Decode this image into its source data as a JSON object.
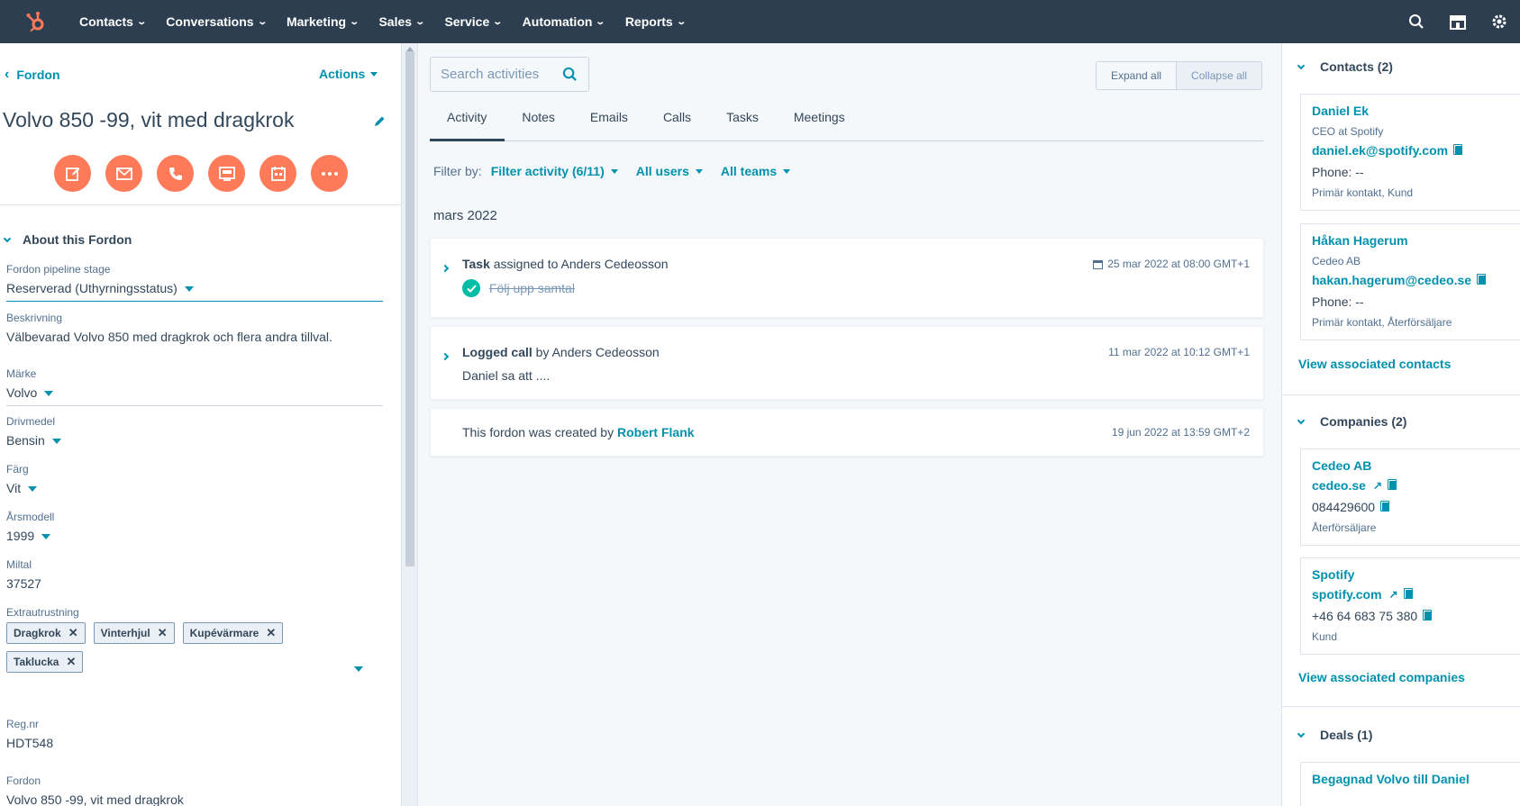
{
  "nav": {
    "items": [
      "Contacts",
      "Conversations",
      "Marketing",
      "Sales",
      "Service",
      "Automation",
      "Reports"
    ],
    "brand_color": "#ff7a59",
    "icons": [
      "search-icon",
      "marketplace-icon",
      "settings-icon"
    ]
  },
  "record": {
    "back_label": "Fordon",
    "actions_label": "Actions",
    "title": "Volvo 850 -99, vit med dragkrok",
    "action_icons": [
      "note-icon",
      "email-icon",
      "call-icon",
      "log-icon",
      "task-icon",
      "more-icon"
    ]
  },
  "about": {
    "heading": "About this Fordon",
    "pipeline_label": "Fordon pipeline stage",
    "pipeline_value": "Reserverad (Uthyrningsstatus)",
    "desc_label": "Beskrivning",
    "desc_value": "Välbevarad Volvo 850 med dragkrok och flera andra tillval.",
    "make_label": "Märke",
    "make_value": "Volvo",
    "fuel_label": "Drivmedel",
    "fuel_value": "Bensin",
    "color_label": "Färg",
    "color_value": "Vit",
    "year_label": "Årsmodell",
    "year_value": "1999",
    "mileage_label": "Miltal",
    "mileage_value": "37527",
    "extras_label": "Extrautrustning",
    "extras": [
      "Dragkrok",
      "Vinterhjul",
      "Kupévärmare",
      "Taklucka"
    ],
    "reg_label": "Reg.nr",
    "reg_value": "HDT548",
    "fordon_label": "Fordon",
    "fordon_value": "Volvo 850 -99, vit med dragkrok"
  },
  "activity": {
    "search_placeholder": "Search activities",
    "expand_all": "Expand all",
    "collapse_all": "Collapse all",
    "tabs": [
      "Activity",
      "Notes",
      "Emails",
      "Calls",
      "Tasks",
      "Meetings"
    ],
    "filter_by": "Filter by:",
    "filter_activity": "Filter activity (6/11)",
    "all_users": "All users",
    "all_teams": "All teams",
    "month": "mars 2022",
    "items": [
      {
        "type": "Task",
        "rest": " assigned to Anders Cedeosson",
        "date": "25 mar 2022 at 08:00 GMT+1",
        "body": "Följ upp samtal"
      },
      {
        "type": "Logged call",
        "rest": " by Anders Cedeosson",
        "date": "11 mar 2022 at 10:12 GMT+1",
        "body": "Daniel sa att ...."
      },
      {
        "text": "This fordon was created by ",
        "author": "Robert Flank",
        "date": "19 jun 2022 at 13:59 GMT+2"
      }
    ]
  },
  "sidebar": {
    "contacts_heading": "Contacts (2)",
    "contacts": [
      {
        "name": "Daniel Ek",
        "title": "CEO at Spotify",
        "email": "daniel.ek@spotify.com",
        "phone": "Phone: --",
        "tags": "Primär kontakt, Kund"
      },
      {
        "name": "Håkan Hagerum",
        "title": "Cedeo AB",
        "email": "hakan.hagerum@cedeo.se",
        "phone": "Phone: --",
        "tags": "Primär kontakt, Återförsäljare"
      }
    ],
    "view_contacts": "View associated contacts",
    "companies_heading": "Companies (2)",
    "companies": [
      {
        "name": "Cedeo AB",
        "domain": "cedeo.se",
        "phone": "084429600",
        "type": "Återförsäljare"
      },
      {
        "name": "Spotify",
        "domain": "spotify.com",
        "phone": "+46 64 683 75 380",
        "type": "Kund"
      }
    ],
    "view_companies": "View associated companies",
    "deals_heading": "Deals (1)",
    "deal_name": "Begagnad Volvo till Daniel"
  }
}
